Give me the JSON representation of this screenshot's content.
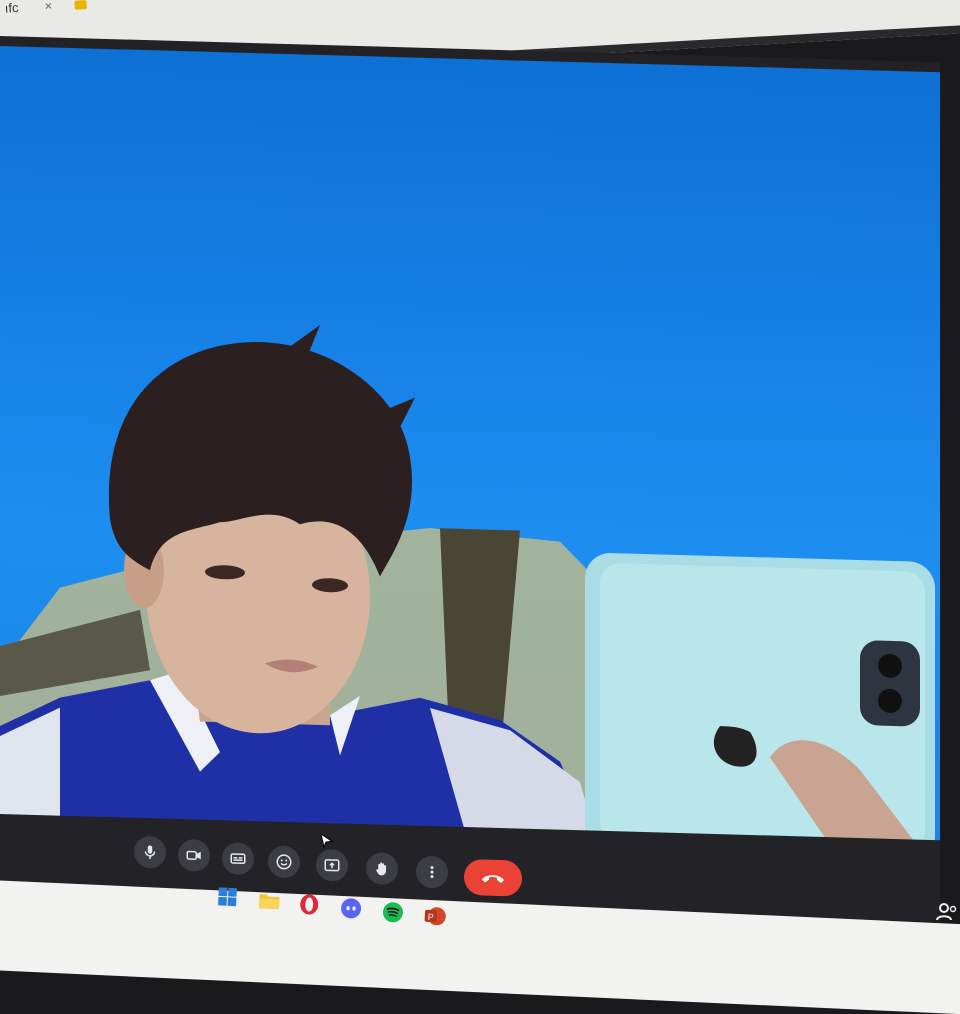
{
  "browser": {
    "tab_fragment": "ıfc",
    "tab_close": "×",
    "favicon_color": "#e8b500"
  },
  "meeting": {
    "background_color": "#1680e6",
    "controls": [
      {
        "name": "microphone",
        "icon": "microphone-icon"
      },
      {
        "name": "camera",
        "icon": "camera-icon"
      },
      {
        "name": "captions",
        "icon": "captions-icon"
      },
      {
        "name": "reactions",
        "icon": "emoji-icon"
      },
      {
        "name": "present-screen",
        "icon": "present-icon"
      },
      {
        "name": "raise-hand",
        "icon": "hand-icon"
      },
      {
        "name": "more-options",
        "icon": "more-vert-icon"
      }
    ],
    "end_call": {
      "icon": "phone-hangup-icon",
      "color": "#ea4335"
    },
    "side": {
      "info_icon": "i",
      "people_icon": "people-icon"
    }
  },
  "taskbar": {
    "apps": [
      {
        "name": "windows-start",
        "color": "#2b7fd9"
      },
      {
        "name": "file-explorer",
        "color": "#f2c230"
      },
      {
        "name": "opera",
        "color": "#e0283a"
      },
      {
        "name": "discord",
        "color": "#5865f2"
      },
      {
        "name": "spotify",
        "color": "#1db954"
      },
      {
        "name": "powerpoint",
        "color": "#d24726"
      }
    ]
  }
}
